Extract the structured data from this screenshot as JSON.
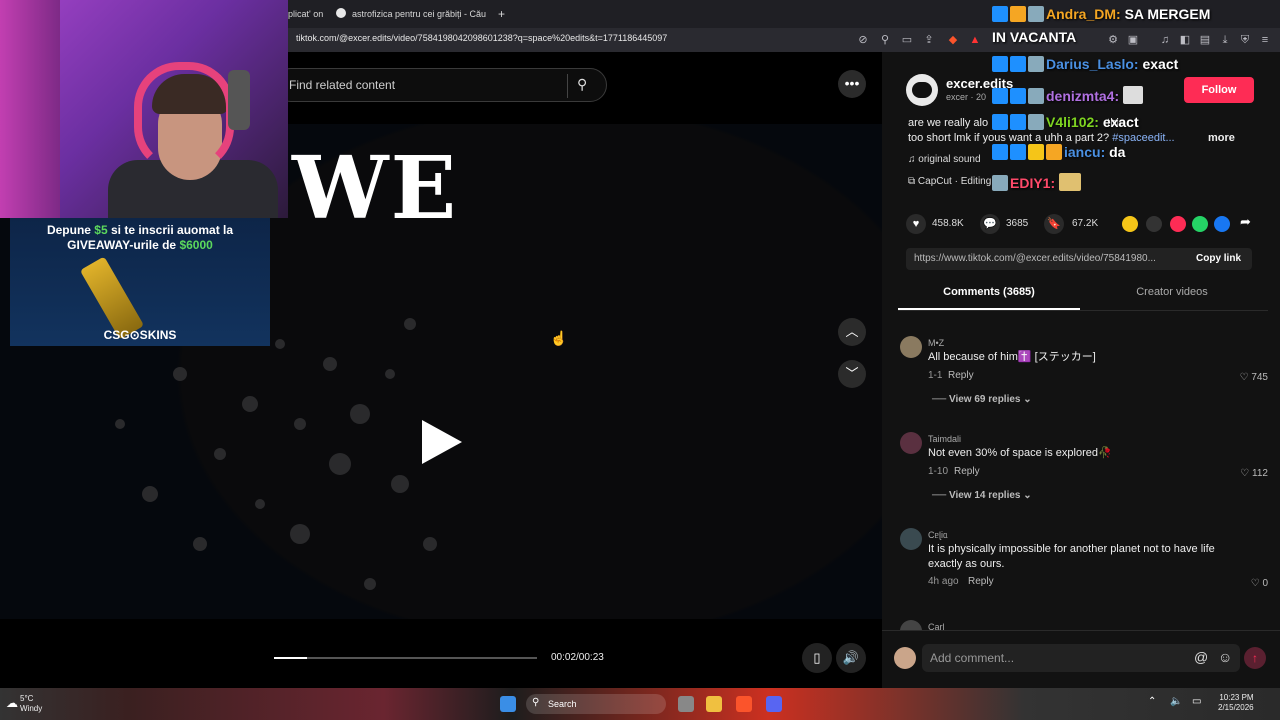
{
  "browser": {
    "tabs": [
      {
        "label": "plicat' on"
      },
      {
        "label": "astrofizica pentru cei grăbiți - Căutar"
      }
    ],
    "new_tab": "+",
    "url": "tiktok.com/@excer.edits/video/7584198042098601238?q=space%20edits&t=1771186445097"
  },
  "video": {
    "search_placeholder": "Find related content",
    "big_word": "WE",
    "time": "00:02/00:23",
    "progress": 0.125
  },
  "post": {
    "username": "excer.edits",
    "subtitle": "excer · 20",
    "follow": "Follow",
    "description": "are we really alo",
    "description_tail": "this",
    "description_line2": "too short lmk if yous want a uhh a part 2? ",
    "hashtag": "#spaceedit...",
    "more": "more",
    "sound": "original sound",
    "capcut": "CapCut · Editing",
    "likes": "458.8K",
    "comments": "3685",
    "saves": "67.2K",
    "link": "https://www.tiktok.com/@excer.edits/video/75841980...",
    "copy_link": "Copy link",
    "tab_comments": "Comments (3685)",
    "tab_creator": "Creator videos"
  },
  "comments": [
    {
      "name": "M•Z",
      "text": "All because of him✝️ [ステッカー]",
      "meta": "1-1",
      "reply": "Reply",
      "likes": "745",
      "view": "View 69 replies"
    },
    {
      "name": "Taimdali",
      "text": "Not even 30% of space is explored🥀",
      "meta": "1-10",
      "reply": "Reply",
      "likes": "112",
      "view": "View 14 replies"
    },
    {
      "name": "Cᥱɭіᥲ",
      "text": "It is physically impossible for another planet not to have life exactly as ours.",
      "meta": "4h ago",
      "reply": "Reply",
      "likes": "0"
    },
    {
      "name": "Carl"
    }
  ],
  "comment_box": {
    "placeholder": "Add comment...",
    "at": "@",
    "emoji": "☺"
  },
  "ad": {
    "line1a": "Depune ",
    "amount1": "$5",
    "line1b": " si te inscrii auomat la",
    "line2a": "GIVEAWAY-urile de ",
    "amount2": "$6000",
    "logo": "CSG⊙SKINS"
  },
  "chat": [
    {
      "user": "Andra_DM:",
      "msg": "SA MERGEM",
      "color": "#f5a623"
    },
    {
      "user": "",
      "msg": "IN VACANTA",
      "color": "#ffffff"
    },
    {
      "user": "Darius_Laslo:",
      "msg": "exact",
      "color": "#4a90e2"
    },
    {
      "user": "denizmta4:",
      "msg": "",
      "color": "#b070e0"
    },
    {
      "user": "V4li102:",
      "msg": "exact",
      "color": "#7ed321"
    },
    {
      "user": "iancu:",
      "msg": "da",
      "color": "#4a90e2"
    },
    {
      "user": "EDIY1:",
      "msg": "",
      "color": "#ff4a6a"
    }
  ],
  "taskbar": {
    "temp": "5°C",
    "weather": "Windy",
    "search": "Search",
    "time": "10:23 PM",
    "date": "2/15/2026"
  }
}
